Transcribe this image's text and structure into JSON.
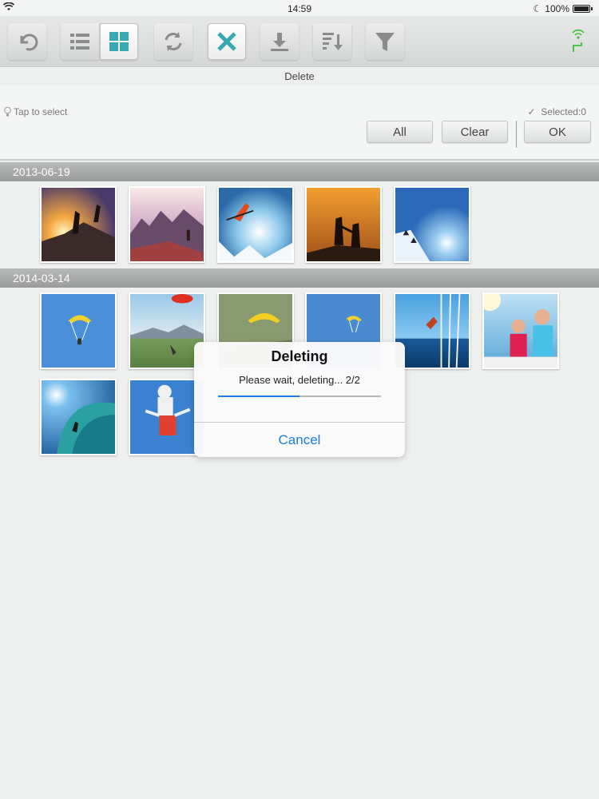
{
  "status_bar": {
    "time": "14:59",
    "battery": "100%"
  },
  "toolbar": {
    "buttons": [
      {
        "name": "back-button",
        "icon": "undo-icon"
      },
      {
        "name": "list-view-button",
        "icon": "list-icon"
      },
      {
        "name": "grid-view-button",
        "icon": "grid-icon"
      },
      {
        "name": "refresh-button",
        "icon": "refresh-icon"
      },
      {
        "name": "delete-button",
        "icon": "close-icon"
      },
      {
        "name": "download-button",
        "icon": "download-icon"
      },
      {
        "name": "sort-button",
        "icon": "sort-icon"
      },
      {
        "name": "filter-button",
        "icon": "filter-icon"
      }
    ],
    "accent": "#3aa8b0"
  },
  "title": "Delete",
  "selection": {
    "hint": "Tap to select",
    "selected_label": "Selected:0",
    "all_label": "All",
    "clear_label": "Clear",
    "ok_label": "OK"
  },
  "groups": [
    {
      "date": "2013-06-19",
      "count": 5
    },
    {
      "date": "2014-03-14",
      "count": 8
    }
  ],
  "dialog": {
    "title": "Deleting",
    "message": "Please wait, deleting... 2/2",
    "progress": 0.5,
    "cancel_label": "Cancel",
    "accent": "#1a7ee0"
  }
}
